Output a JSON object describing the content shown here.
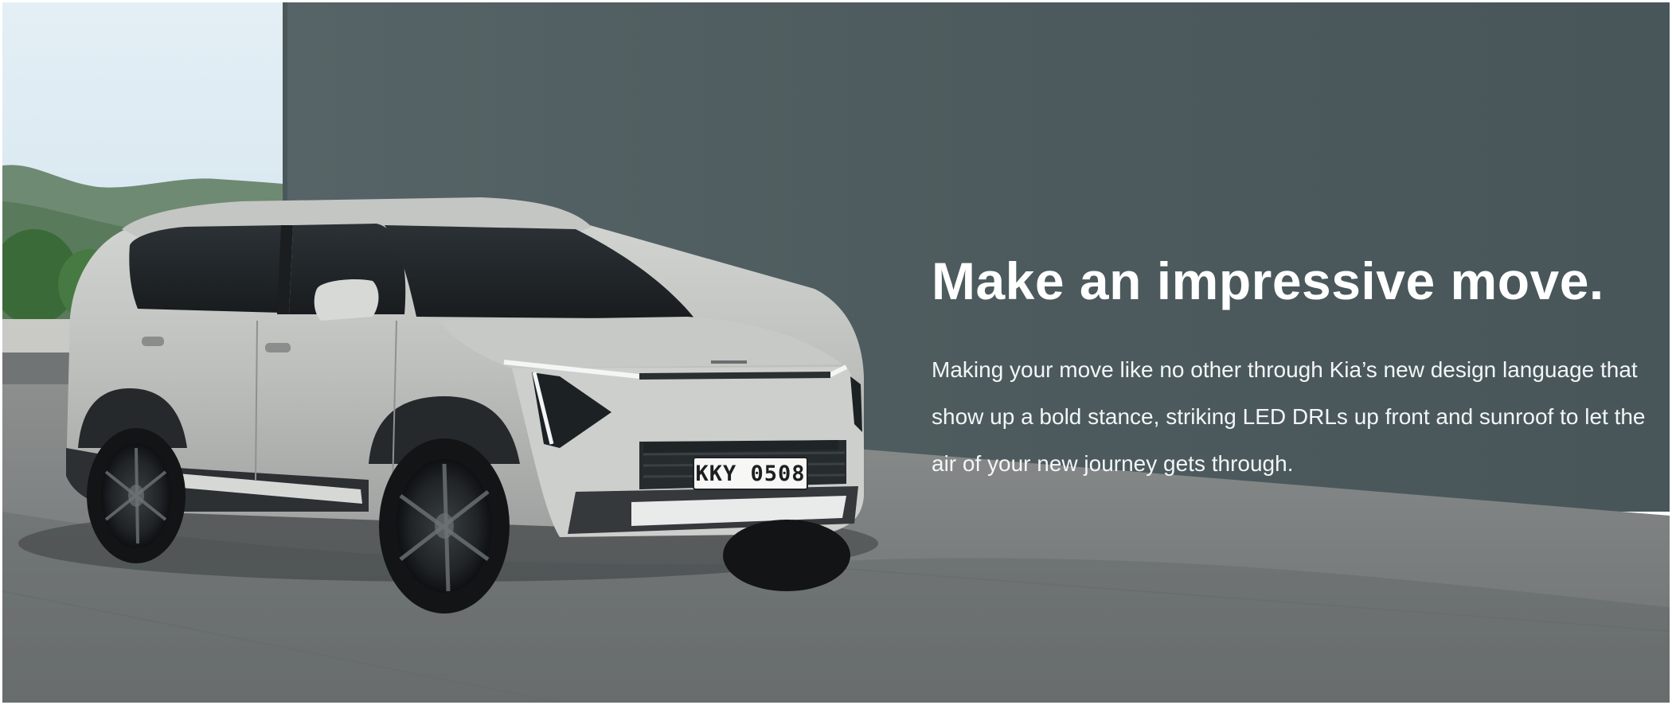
{
  "hero": {
    "headline": "Make an impressive move.",
    "body": "Making your move like no other through Kia’s new design language that show up a bold stance, striking LED DRLs up front and sunroof to let the air of your new journey gets through.",
    "plate": "KKY 0508",
    "colors": {
      "wall": "#4c5a5c",
      "sky": "#d9e9f1",
      "ground": "#7e8282",
      "car_body": "#bcbfbc",
      "text": "#ffffff"
    }
  }
}
